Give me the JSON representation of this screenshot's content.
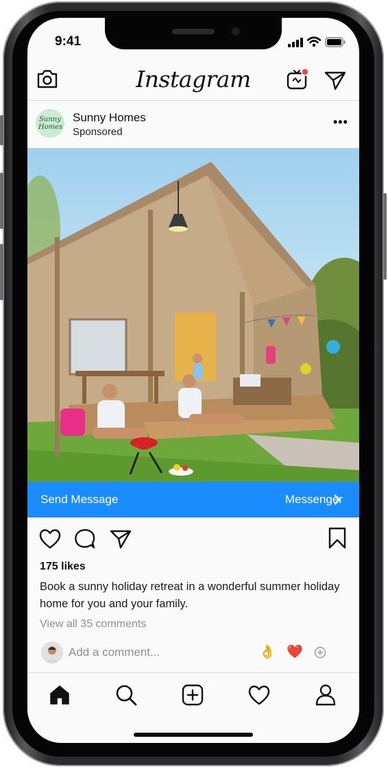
{
  "status_bar": {
    "time": "9:41"
  },
  "header": {
    "app_title": "Instagram"
  },
  "post": {
    "account_name": "Sunny Homes",
    "account_logo_text": "Sunny Homes",
    "label": "Sponsored",
    "cta": {
      "left_label": "Send Message",
      "right_label": "Messenger",
      "right_chevron": "›"
    },
    "likes": "175 likes",
    "caption": "Book a sunny holiday retreat in a wonderful summer holiday home for you and your family.",
    "view_comments": "View all 35 comments",
    "comment_placeholder": "Add a comment...",
    "quick_reactions": [
      "👌",
      "❤️"
    ]
  },
  "colors": {
    "cta_background": "#1a8cff",
    "notification_dot": "#ed4956"
  },
  "icons": {
    "header": [
      "camera-icon",
      "igtv-icon",
      "direct-send-icon"
    ],
    "actions": [
      "heart-icon",
      "comment-icon",
      "share-icon",
      "bookmark-icon"
    ],
    "tabs": [
      "home-icon",
      "search-icon",
      "new-post-icon",
      "activity-icon",
      "profile-icon"
    ]
  }
}
